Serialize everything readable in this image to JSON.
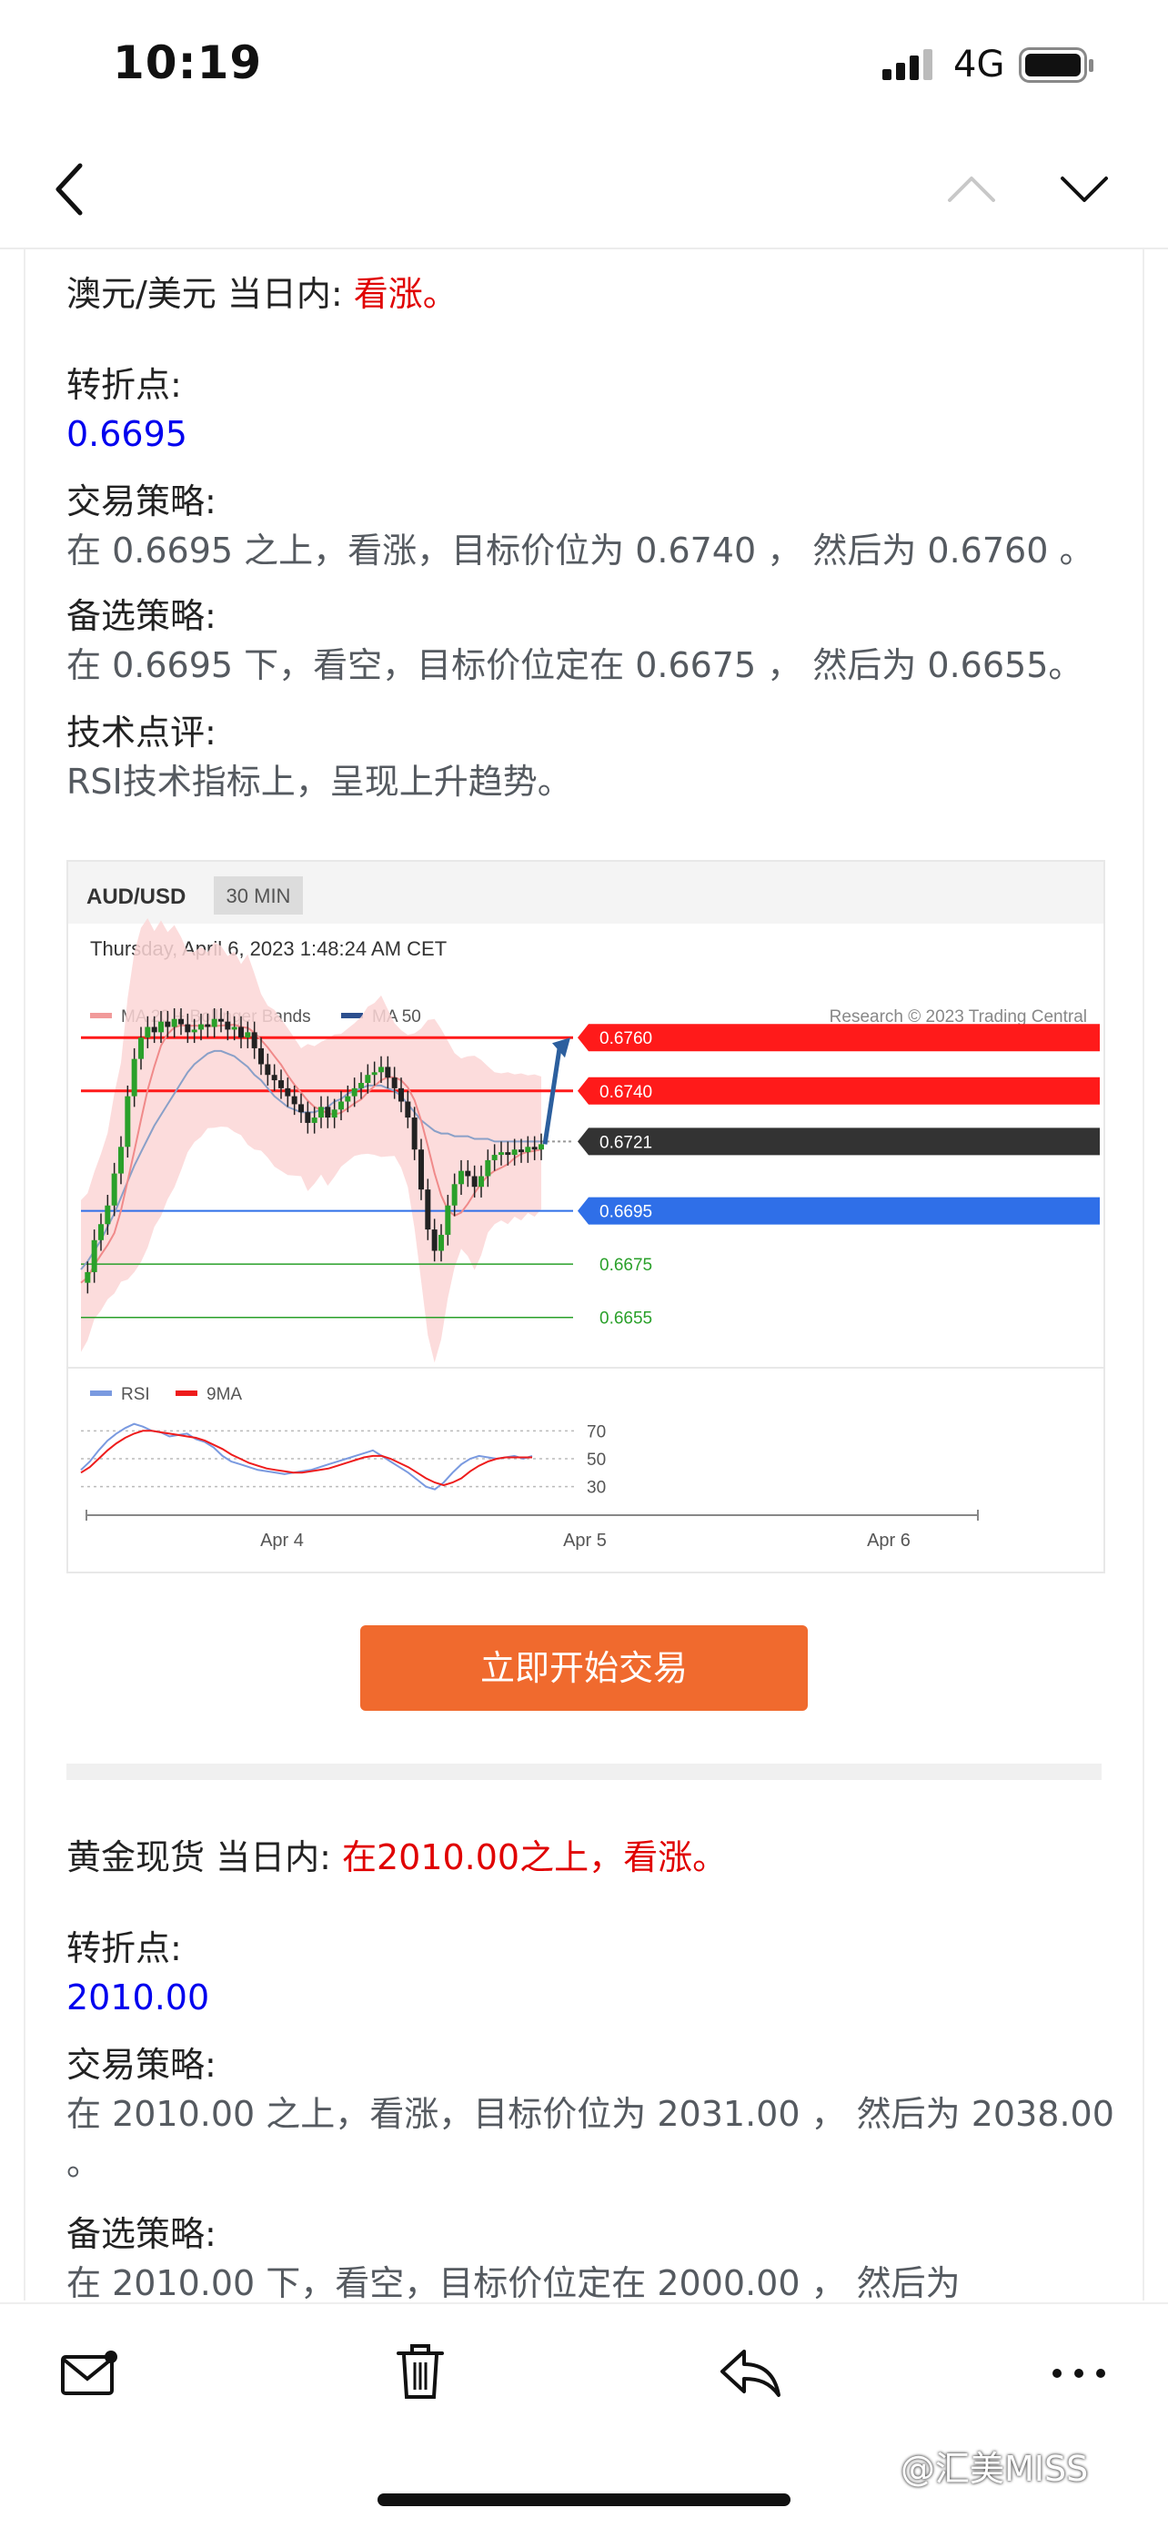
{
  "status_bar": {
    "time": "10:19",
    "network": "4G"
  },
  "nav": {
    "back_icon": "chevron-left-icon",
    "prev_icon": "chevron-up-icon",
    "next_icon": "chevron-down-icon"
  },
  "aud": {
    "title_prefix": "澳元/美元 当日内: ",
    "title_bias": "看涨。",
    "pivot_label": "转折点:",
    "pivot_value": "0.6695",
    "strategy_label": "交易策略:",
    "strategy_text": "在 0.6695 之上，看涨，目标价位为 0.6740 ， 然后为 0.6760 。",
    "alt_label": "备选策略:",
    "alt_text": "在 0.6695 下，看空，目标价位定在 0.6675 ， 然后为 0.6655。",
    "comment_label": "技术点评:",
    "comment_text": "RSI技术指标上，呈现上升趋势。"
  },
  "chart_data": {
    "type": "line",
    "title": "AUD/USD",
    "timeframe": "30 MIN",
    "subtitle": "Thursday, April 6, 2023 1:48:24 AM CET",
    "credit": "Research © 2023 Trading Central",
    "legend": [
      "MA 20 + Bollinger Bands",
      "MA 50"
    ],
    "x_ticks": [
      "Apr 4",
      "Apr 5",
      "Apr 6"
    ],
    "levels": [
      {
        "value": "0.6760",
        "color": "#ff1a1a",
        "style": "badge"
      },
      {
        "value": "0.6740",
        "color": "#ff1a1a",
        "style": "badge"
      },
      {
        "value": "0.6721",
        "color": "#333333",
        "style": "badge"
      },
      {
        "value": "0.6695",
        "color": "#2f6fe8",
        "style": "badge"
      },
      {
        "value": "0.6675",
        "color": "#2aa02a",
        "style": "text"
      },
      {
        "value": "0.6655",
        "color": "#2aa02a",
        "style": "text"
      }
    ],
    "ylim": [
      0.6645,
      0.6785
    ],
    "price_series": [
      0.6668,
      0.6672,
      0.6684,
      0.669,
      0.6697,
      0.6709,
      0.6719,
      0.6738,
      0.6752,
      0.676,
      0.6764,
      0.6762,
      0.6766,
      0.6764,
      0.6767,
      0.6765,
      0.6762,
      0.6763,
      0.6765,
      0.6764,
      0.6767,
      0.6766,
      0.6763,
      0.6764,
      0.676,
      0.6762,
      0.6756,
      0.675,
      0.6746,
      0.6744,
      0.6741,
      0.6738,
      0.6735,
      0.6732,
      0.6728,
      0.673,
      0.6734,
      0.673,
      0.6733,
      0.6736,
      0.6738,
      0.6741,
      0.6743,
      0.6746,
      0.6747,
      0.6749,
      0.6745,
      0.6741,
      0.6736,
      0.673,
      0.6718,
      0.6703,
      0.6688,
      0.668,
      0.6686,
      0.6697,
      0.6705,
      0.671,
      0.6708,
      0.6704,
      0.6708,
      0.6714,
      0.6716,
      0.6717,
      0.6716,
      0.6718,
      0.6717,
      0.6719,
      0.6718,
      0.672
    ],
    "ma50_series": [
      0.6673,
      0.6676,
      0.668,
      0.6684,
      0.6689,
      0.6694,
      0.67,
      0.6706,
      0.6712,
      0.6717,
      0.6722,
      0.6727,
      0.6731,
      0.6735,
      0.6739,
      0.6743,
      0.6747,
      0.675,
      0.6752,
      0.6754,
      0.6755,
      0.6755,
      0.6754,
      0.6753,
      0.6751,
      0.6749,
      0.6746,
      0.6744,
      0.6741,
      0.6738,
      0.6736,
      0.6734,
      0.6733,
      0.6732,
      0.6732,
      0.6732,
      0.6733,
      0.6734,
      0.6736,
      0.6737,
      0.6739,
      0.674,
      0.6741,
      0.6742,
      0.6742,
      0.6742,
      0.6741,
      0.674,
      0.6738,
      0.6735,
      0.6732,
      0.6729,
      0.6727,
      0.6725,
      0.6724,
      0.6724,
      0.6723,
      0.6723,
      0.6723,
      0.6722,
      0.6722,
      0.6722,
      0.6721,
      0.6721,
      0.6721,
      0.6721,
      0.6721,
      0.6721,
      0.6721,
      0.6721
    ],
    "rsi": {
      "legend": [
        "RSI",
        "9MA"
      ],
      "ticks": [
        70,
        50,
        30
      ],
      "ylim": [
        20,
        80
      ],
      "rsi_series": [
        42,
        48,
        56,
        63,
        68,
        72,
        75,
        73,
        70,
        69,
        66,
        67,
        68,
        64,
        62,
        58,
        52,
        48,
        46,
        44,
        42,
        41,
        40,
        39,
        40,
        41,
        42,
        44,
        46,
        48,
        50,
        52,
        54,
        56,
        52,
        48,
        44,
        40,
        35,
        30,
        28,
        33,
        40,
        46,
        50,
        52,
        51,
        50,
        51,
        52,
        50,
        52
      ],
      "ma_series": [
        40,
        44,
        50,
        56,
        61,
        65,
        68,
        70,
        70,
        69,
        68,
        67,
        66,
        65,
        63,
        60,
        57,
        53,
        50,
        47,
        45,
        43,
        42,
        41,
        40,
        40,
        41,
        42,
        43,
        45,
        47,
        49,
        51,
        52,
        52,
        50,
        47,
        44,
        40,
        36,
        33,
        31,
        33,
        36,
        41,
        45,
        48,
        50,
        51,
        51,
        51,
        51
      ]
    }
  },
  "cta": {
    "label": "立即开始交易"
  },
  "gold": {
    "title_prefix": "黄金现货 当日内: ",
    "title_bias": "在2010.00之上，看涨。",
    "pivot_label": "转折点:",
    "pivot_value": "2010.00",
    "strategy_label": "交易策略:",
    "strategy_text": "在 2010.00 之上，看涨，目标价位为 2031.00 ， 然后为 2038.00",
    "strategy_tail": "。",
    "alt_label": "备选策略:",
    "alt_text": "在 2010.00 下，看空，目标价位定在 2000.00 ， 然后为"
  },
  "toolbar": {
    "icons": [
      "mail-icon",
      "trash-icon",
      "reply-icon",
      "more-icon"
    ]
  },
  "watermark": "@汇美MISS"
}
